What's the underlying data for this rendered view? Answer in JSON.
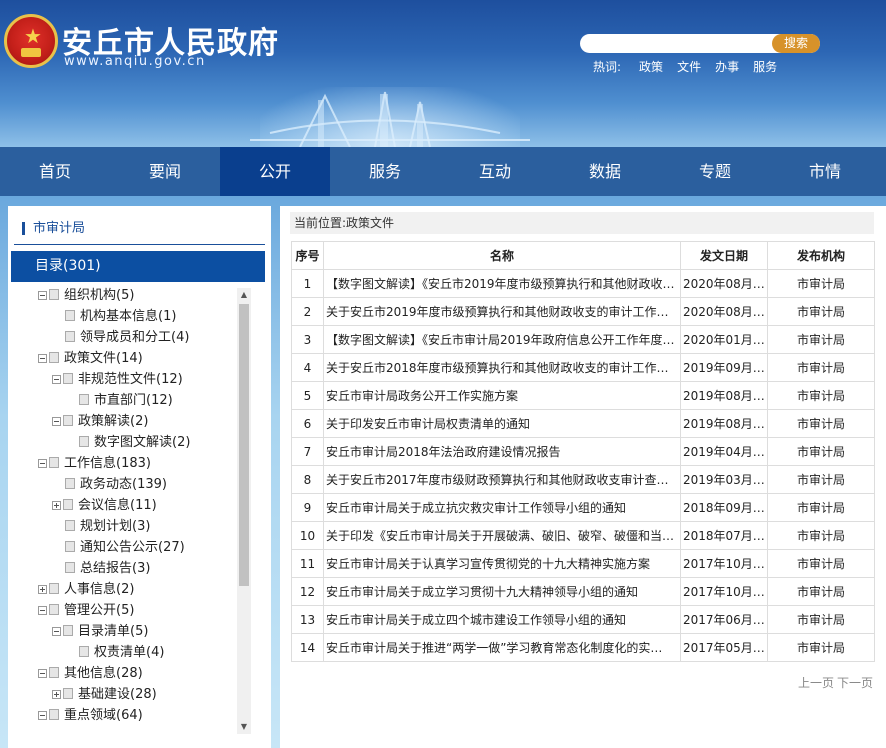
{
  "header": {
    "title": "安丘市人民政府",
    "url": "www.anqiu.gov.cn",
    "search": {
      "placeholder": "",
      "button_label": "搜索"
    },
    "hotwords": {
      "label": "热词:",
      "items": [
        "政策",
        "文件",
        "办事",
        "服务"
      ]
    }
  },
  "nav": {
    "items": [
      "首页",
      "要闻",
      "公开",
      "服务",
      "互动",
      "数据",
      "专题",
      "市情"
    ],
    "active_index": 2
  },
  "sidebar": {
    "department": "市审计局",
    "catalog_label": "目录(301)",
    "tree": [
      {
        "label": "组织机构(5)",
        "level": 0,
        "toggle": "minus"
      },
      {
        "label": "机构基本信息(1)",
        "level": 1,
        "toggle": "none"
      },
      {
        "label": "领导成员和分工(4)",
        "level": 1,
        "toggle": "none"
      },
      {
        "label": "政策文件(14)",
        "level": 0,
        "toggle": "minus"
      },
      {
        "label": "非规范性文件(12)",
        "level": 1,
        "toggle": "minus"
      },
      {
        "label": "市直部门(12)",
        "level": 2,
        "toggle": "none"
      },
      {
        "label": "政策解读(2)",
        "level": 1,
        "toggle": "minus"
      },
      {
        "label": "数字图文解读(2)",
        "level": 2,
        "toggle": "none"
      },
      {
        "label": "工作信息(183)",
        "level": 0,
        "toggle": "minus"
      },
      {
        "label": "政务动态(139)",
        "level": 1,
        "toggle": "none"
      },
      {
        "label": "会议信息(11)",
        "level": 1,
        "toggle": "plus"
      },
      {
        "label": "规划计划(3)",
        "level": 1,
        "toggle": "none"
      },
      {
        "label": "通知公告公示(27)",
        "level": 1,
        "toggle": "none"
      },
      {
        "label": "总结报告(3)",
        "level": 1,
        "toggle": "none"
      },
      {
        "label": "人事信息(2)",
        "level": 0,
        "toggle": "plus"
      },
      {
        "label": "管理公开(5)",
        "level": 0,
        "toggle": "minus"
      },
      {
        "label": "目录清单(5)",
        "level": 1,
        "toggle": "minus"
      },
      {
        "label": "权责清单(4)",
        "level": 2,
        "toggle": "none"
      },
      {
        "label": "其他信息(28)",
        "level": 0,
        "toggle": "minus"
      },
      {
        "label": "基础建设(28)",
        "level": 1,
        "toggle": "plus"
      },
      {
        "label": "重点领域(64)",
        "level": 0,
        "toggle": "minus"
      }
    ]
  },
  "main": {
    "breadcrumb_label": "当前位置:",
    "breadcrumb_value": "政策文件",
    "table": {
      "headers": [
        "序号",
        "名称",
        "发文日期",
        "发布机构"
      ],
      "rows": [
        [
          "1",
          "【数字图文解读】《安丘市2019年度市级预算执行和其他财政收…",
          "2020年08月…",
          "市审计局"
        ],
        [
          "2",
          "关于安丘市2019年度市级预算执行和其他财政收支的审计工作报…",
          "2020年08月…",
          "市审计局"
        ],
        [
          "3",
          "【数字图文解读】《安丘市审计局2019年政府信息公开工作年度…",
          "2020年01月…",
          "市审计局"
        ],
        [
          "4",
          "关于安丘市2018年度市级预算执行和其他财政收支的审计工作报…",
          "2019年09月…",
          "市审计局"
        ],
        [
          "5",
          "安丘市审计局政务公开工作实施方案",
          "2019年08月…",
          "市审计局"
        ],
        [
          "6",
          "关于印发安丘市审计局权责清单的通知",
          "2019年08月…",
          "市审计局"
        ],
        [
          "7",
          "安丘市审计局2018年法治政府建设情况报告",
          "2019年04月…",
          "市审计局"
        ],
        [
          "8",
          "关于安丘市2017年度市级财政预算执行和其他财政收支审计查出…",
          "2019年03月…",
          "市审计局"
        ],
        [
          "9",
          "安丘市审计局关于成立抗灾救灾审计工作领导小组的通知",
          "2018年09月…",
          "市审计局"
        ],
        [
          "10",
          "关于印发《安丘市审计局关于开展破满、破旧、破窄、破僵和当…",
          "2018年07月…",
          "市审计局"
        ],
        [
          "11",
          "安丘市审计局关于认真学习宣传贯彻党的十九大精神实施方案",
          "2017年10月…",
          "市审计局"
        ],
        [
          "12",
          "安丘市审计局关于成立学习贯彻十九大精神领导小组的通知",
          "2017年10月…",
          "市审计局"
        ],
        [
          "13",
          "安丘市审计局关于成立四个城市建设工作领导小组的通知",
          "2017年06月…",
          "市审计局"
        ],
        [
          "14",
          "安丘市审计局关于推进“两学一做”学习教育常态化制度化的实…",
          "2017年05月…",
          "市审计局"
        ]
      ]
    },
    "pager": {
      "prev": "上一页",
      "next": "下一页"
    }
  },
  "colors": {
    "nav_bg": "#2b5f9e",
    "nav_active": "#0a3f8e",
    "catalog_bar": "#0c4fa2",
    "search_button": "#d7922a"
  }
}
